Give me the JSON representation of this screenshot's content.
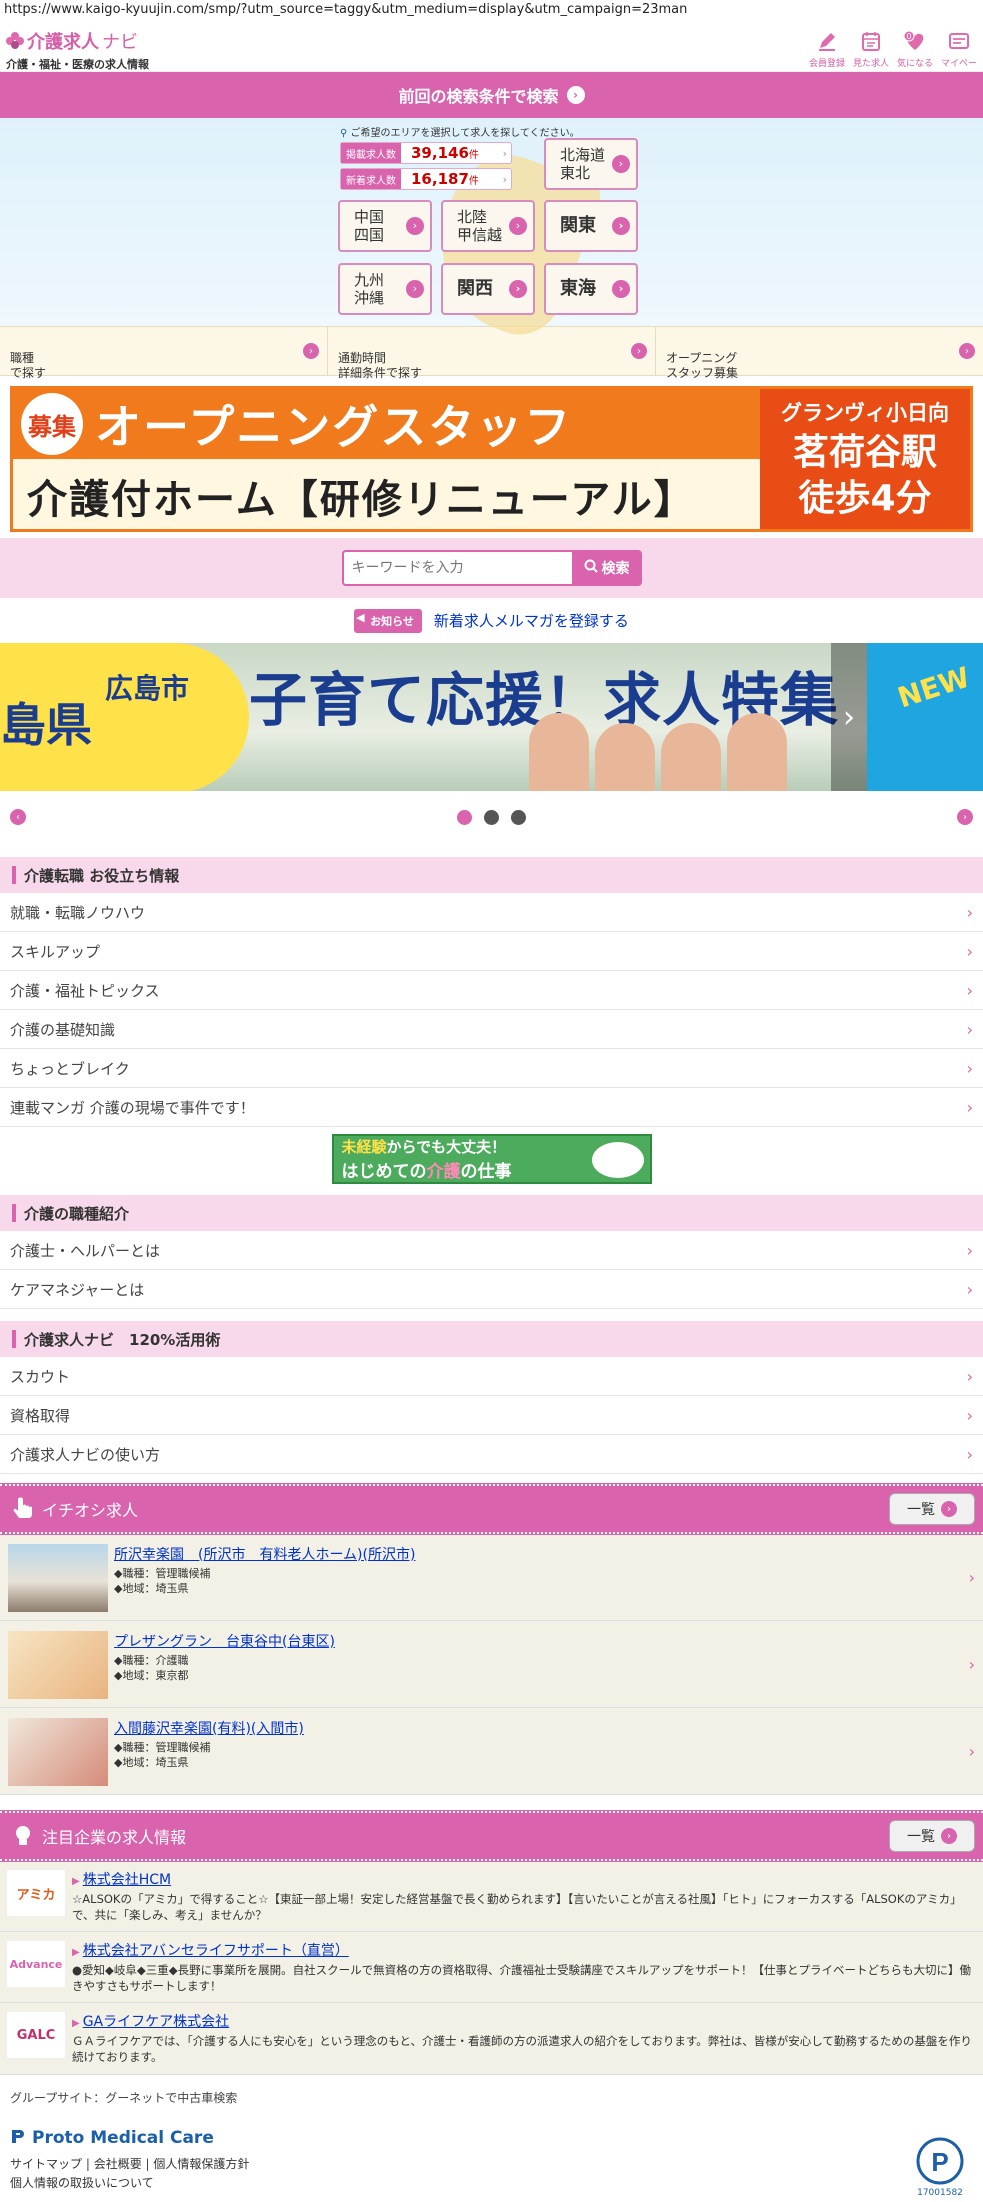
{
  "browser": {
    "url": "https://www.kaigo-kyuujin.com/smp/?utm_source=taggy&utm_medium=display&utm_campaign=23man"
  },
  "header": {
    "logo_name": "介護求人",
    "logo_accent": "ナビ",
    "logo_sub": "介護・福祉・医療の求人情報",
    "icons": [
      {
        "label": "会員登録",
        "icon": "pencil-icon"
      },
      {
        "label": "見た求人",
        "icon": "calendar-icon"
      },
      {
        "label": "気になる",
        "icon": "heart-icon"
      },
      {
        "label": "マイページ",
        "icon": "mypage-icon"
      }
    ]
  },
  "last_search": {
    "label": "前回の検索条件で検索"
  },
  "area": {
    "note": "ご希望のエリアを選択して求人を探してください。",
    "total_label": "掲載求人数",
    "total_value": "39,146",
    "new_label": "新着求人数",
    "new_value": "16,187",
    "unit": "件",
    "regions": [
      {
        "name": "北海道\n東北"
      },
      {
        "name": "中国\n四国"
      },
      {
        "name": "北陸\n甲信越"
      },
      {
        "name": "関東"
      },
      {
        "name": "九州\n沖縄"
      },
      {
        "name": "関西"
      },
      {
        "name": "東海"
      }
    ]
  },
  "search_options": [
    {
      "label": "職種\nで探す"
    },
    {
      "label": "通勤時間\n詳細条件で探す"
    },
    {
      "label": "オープニング\nスタッフ募集"
    }
  ],
  "ad_banner": {
    "boshu": "募集",
    "headline": "オープニングスタッフ",
    "subline": "介護付ホーム【研修リニューアル】",
    "facility": "グランヴィ小日向",
    "station": "茗荷谷駅",
    "walk": "徒歩4分"
  },
  "keyword": {
    "placeholder": "キーワードを入力",
    "button": "検索"
  },
  "notice": {
    "badge": "お知らせ",
    "link": "新着求人メルマガを登録する"
  },
  "carousel": {
    "prev_text": "島県",
    "city": "広島市",
    "title": "子育て応援！求人特集",
    "next_text": "NEW",
    "dots": [
      true,
      false,
      false
    ]
  },
  "sections": [
    {
      "title": "介護転職 お役立ち情報",
      "items": [
        "就職・転職ノウハウ",
        "スキルアップ",
        "介護・福祉トピックス",
        "介護の基礎知識",
        "ちょっとブレイク",
        "連載マンガ 介護の現場で事件です！"
      ]
    },
    {
      "title": "介護の職種紹介",
      "items": [
        "介護士・ヘルパーとは",
        "ケアマネジャーとは"
      ]
    },
    {
      "title": "介護求人ナビ　120%活用術",
      "items": [
        "スカウト",
        "資格取得",
        "介護求人ナビの使い方"
      ]
    }
  ],
  "mid_banner": {
    "line1a": "未経験",
    "line1b": "からでも大丈夫！",
    "line2a": "はじめての",
    "line2b": "介護",
    "line2c": "の仕事"
  },
  "featured": {
    "title": "イチオシ求人",
    "more": "一覧",
    "jobs": [
      {
        "name": "所沢幸楽園　(所沢市　有料老人ホーム)(所沢市)",
        "job": "◆職種：管理職候補",
        "area": "◆地域：埼玉県"
      },
      {
        "name": "プレザングラン　台東谷中(台東区)",
        "job": "◆職種：介護職",
        "area": "◆地域：東京都"
      },
      {
        "name": "入間藤沢幸楽園(有料)(入間市)",
        "job": "◆職種：管理職候補",
        "area": "◆地域：埼玉県"
      }
    ]
  },
  "companies_sec": {
    "title": "注目企業の求人情報",
    "more": "一覧",
    "items": [
      {
        "logo": "アミカ",
        "name": "株式会社HCM",
        "desc": "☆ALSOKの「アミカ」で得すること☆【東証一部上場！安定した経営基盤で長く勤められます】【言いたいことが言える社風】「ヒト」にフォーカスする「ALSOKのアミカ」で、共に「楽しみ、考え」ませんか？"
      },
      {
        "logo": "Advance",
        "name": "株式会社アバンセライフサポート（直営）",
        "desc": "●愛知◆岐阜◆三重◆長野に事業所を展開。自社スクールで無資格の方の資格取得、介護福祉士受験講座でスキルアップをサポート！【仕事とプライベートどちらも大切に】働きやすさもサポートします！"
      },
      {
        "logo": "GALC",
        "name": "GAライフケア株式会社",
        "desc": "ＧＡライフケアでは、「介護する人にも安心を」という理念のもと、介護士・看護師の方の派遣求人の紹介をしております。弊社は、皆様が安心して勤務するための基盤を作り続けております。"
      }
    ]
  },
  "footer": {
    "group_label": "グループサイト：",
    "group_link": "グーネットで中古車検索",
    "brand": "Proto Medical Care",
    "links": [
      "サイトマップ",
      "会社概要",
      "個人情報保護方針",
      "個人情報の取扱いについて"
    ],
    "pmark_number": "17001582"
  }
}
